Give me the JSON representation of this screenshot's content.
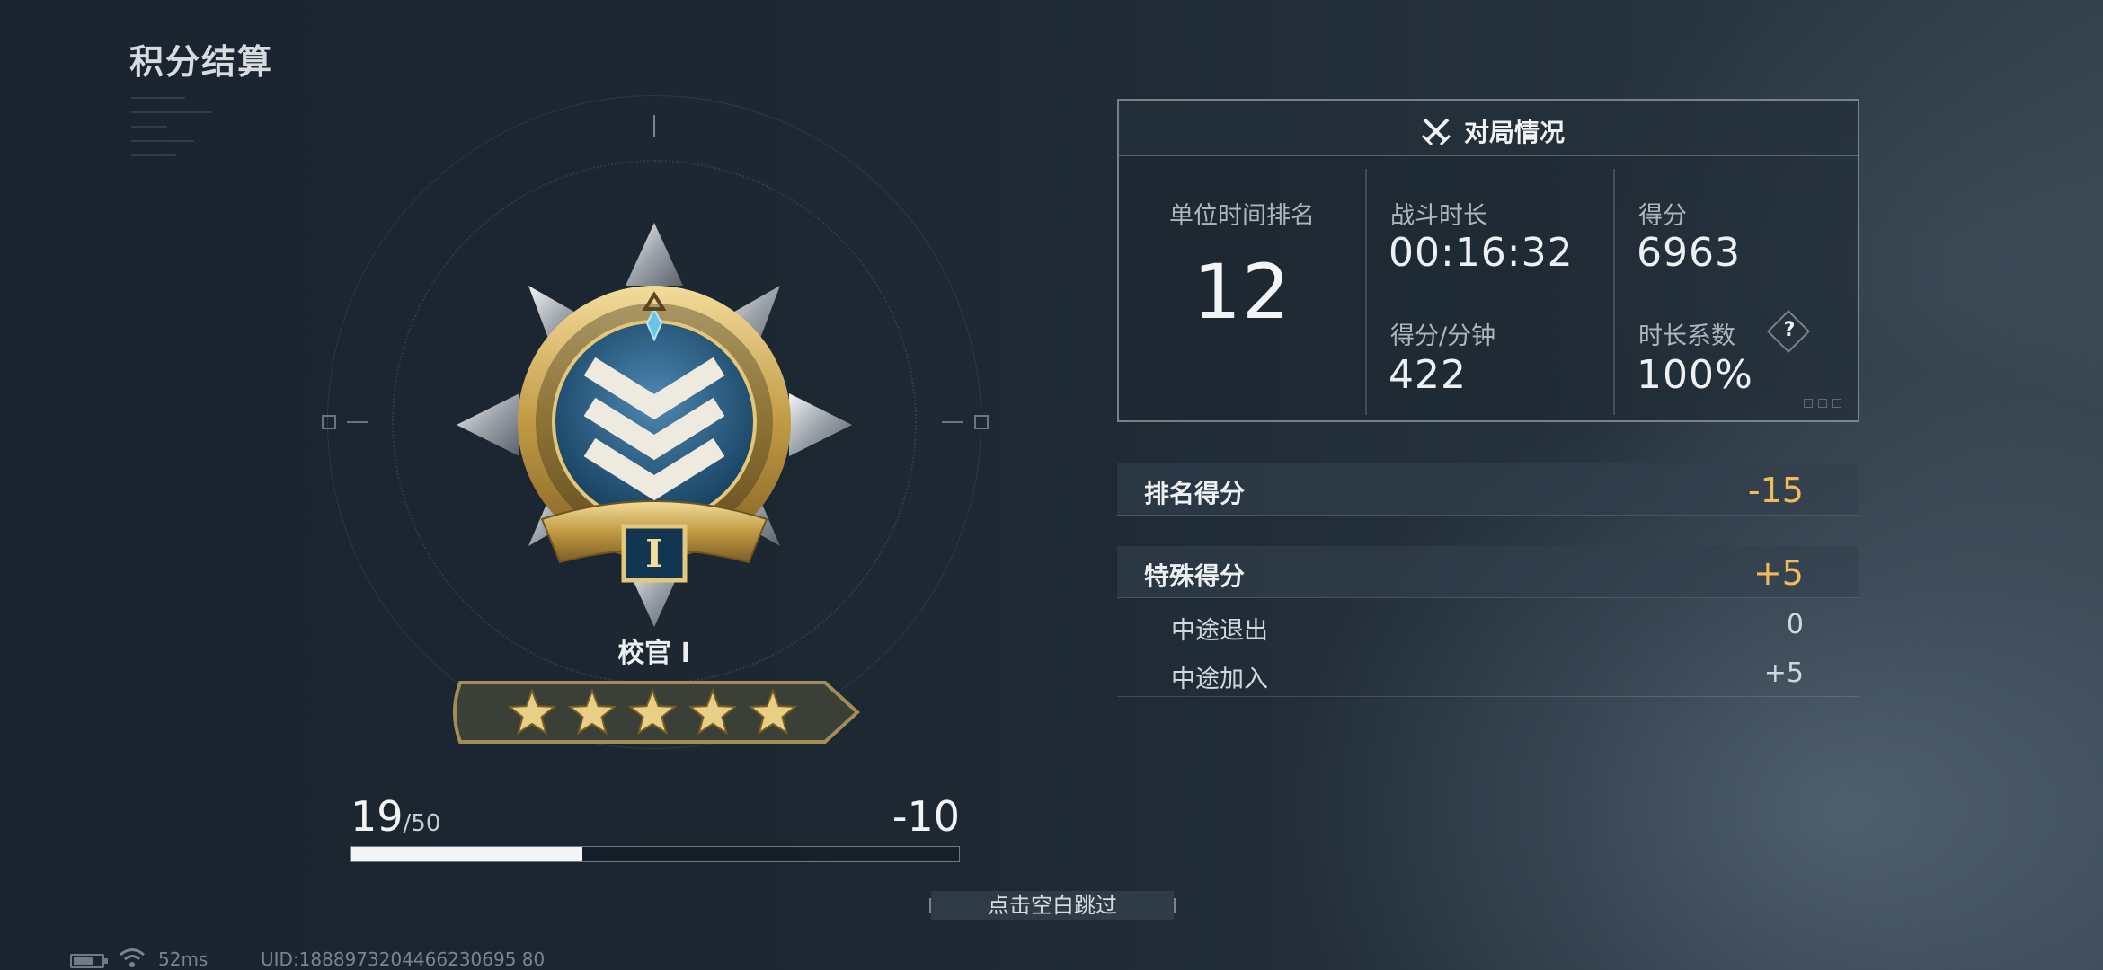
{
  "page": {
    "title": "积分结算"
  },
  "rank": {
    "name": "校官 I",
    "numeral": "I",
    "stars": 5
  },
  "progress": {
    "current": "19",
    "total": "/50",
    "delta": "-10",
    "fraction": 0.38
  },
  "match": {
    "title": "对局情况",
    "rank_label": "单位时间排名",
    "rank_value": "12",
    "duration_label": "战斗时长",
    "duration_value": "00:16:32",
    "score_label": "得分",
    "score_value": "6963",
    "spm_label": "得分/分钟",
    "spm_value": "422",
    "coef_label": "时长系数",
    "coef_value": "100%",
    "help_glyph": "?"
  },
  "scores": {
    "rank_score_label": "排名得分",
    "rank_score_value": "-15",
    "special_score_label": "特殊得分",
    "special_score_value": "+5",
    "items": [
      {
        "label": "中途退出",
        "value": "0"
      },
      {
        "label": "中途加入",
        "value": "+5"
      }
    ]
  },
  "skip": {
    "label": "点击空白跳过"
  },
  "status": {
    "ping": "52ms",
    "uid": "UID:1888973204466230695 80"
  },
  "colors": {
    "accent_gold": "#f0bb5a",
    "panel_border": "#bec8d2",
    "progress_fill": "#f3f4f5"
  },
  "icons": {
    "match": "crossed-swords-icon",
    "help": "help-icon",
    "battery": "battery-icon",
    "wifi": "wifi-icon"
  }
}
